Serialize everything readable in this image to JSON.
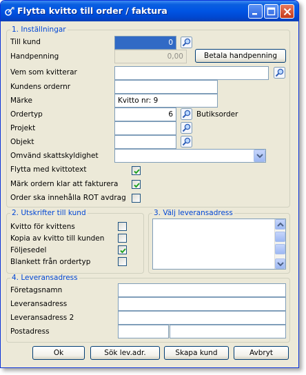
{
  "window": {
    "title": "Flytta kvitto till order / faktura"
  },
  "section1": {
    "legend": "1. Inställningar",
    "till_kund": {
      "label": "Till kund",
      "value": "0"
    },
    "handpenning": {
      "label": "Handpenning",
      "value": "0,00",
      "button": "Betala handpenning"
    },
    "vem_som_kvitterar": {
      "label": "Vem som kvitterar",
      "value": ""
    },
    "kundens_ordernr": {
      "label": "Kundens ordernr",
      "value": ""
    },
    "marke": {
      "label": "Märke",
      "value": "Kvitto nr: 9"
    },
    "ordertyp": {
      "label": "Ordertyp",
      "value": "6",
      "description": "Butiksorder"
    },
    "projekt": {
      "label": "Projekt",
      "value": ""
    },
    "objekt": {
      "label": "Objekt",
      "value": ""
    },
    "omvand": {
      "label": "Omvänd skattskyldighet",
      "value": ""
    },
    "flytta_kvittotext": {
      "label": "Flytta med kvittotext",
      "checked": true
    },
    "mark_ordern": {
      "label": "Märk ordern klar att fakturera",
      "checked": true
    },
    "rot_avdrag": {
      "label": "Order ska innehålla ROT avdrag",
      "checked": false
    }
  },
  "section2": {
    "legend": "2. Utskrifter till kund",
    "items": [
      {
        "label": "Kvitto för kvittens",
        "checked": false
      },
      {
        "label": "Kopia av kvitto till kunden",
        "checked": false
      },
      {
        "label": "Följesedel",
        "checked": true
      },
      {
        "label": "Blankett från ordertyp",
        "checked": false
      }
    ]
  },
  "section3": {
    "legend": "3. Välj leveransadress"
  },
  "section4": {
    "legend": "4. Leveransadress",
    "foretagsnamn": {
      "label": "Företagsnamn",
      "value": ""
    },
    "leveransadress": {
      "label": "Leveransadress",
      "value": ""
    },
    "leveransadress2": {
      "label": "Leveransadress 2",
      "value": ""
    },
    "postadress": {
      "label": "Postadress",
      "zip": "",
      "city": ""
    }
  },
  "buttons": {
    "ok": "Ok",
    "sok": "Sök lev.adr.",
    "skapa": "Skapa kund",
    "avbryt": "Avbryt"
  },
  "colors": {
    "accent": "#0046d5",
    "titlebar": "#0054e3",
    "selection": "#316ac5",
    "check": "#21a121"
  }
}
